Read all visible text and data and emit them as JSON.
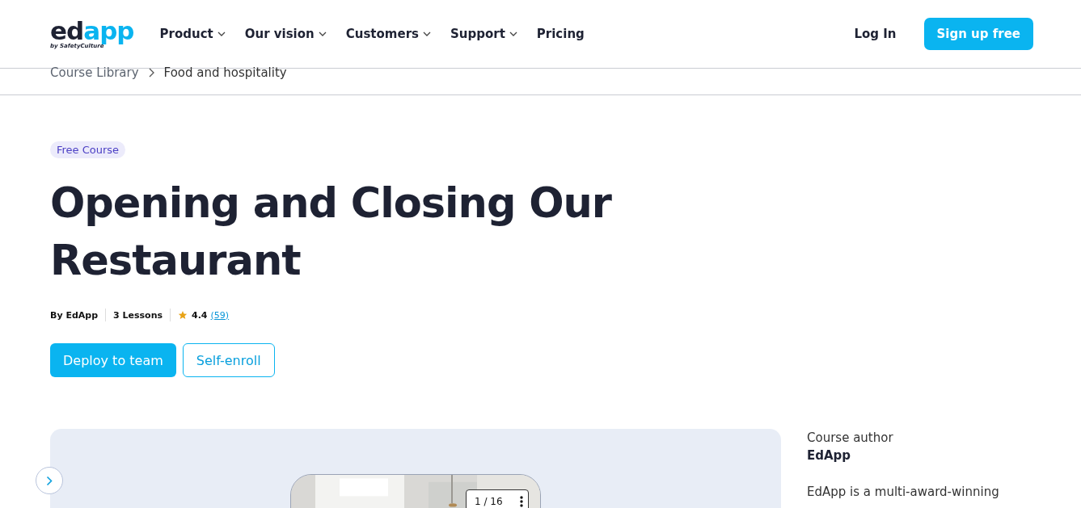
{
  "logo": {
    "primary": "ed",
    "accent": "app",
    "tagline": "by SafetyCulture"
  },
  "nav": [
    {
      "label": "Product",
      "dropdown": true
    },
    {
      "label": "Our vision",
      "dropdown": true
    },
    {
      "label": "Customers",
      "dropdown": true
    },
    {
      "label": "Support",
      "dropdown": true
    },
    {
      "label": "Pricing",
      "dropdown": false
    }
  ],
  "header_actions": {
    "login": "Log In",
    "signup": "Sign up free"
  },
  "breadcrumb": [
    "Course Library",
    "Food and hospitality"
  ],
  "badge": "Free Course",
  "title": "Opening and Closing Our Restaurant",
  "meta": {
    "author": "By EdApp",
    "lessons": "3 Lessons",
    "rating": "4.4",
    "reviews": "(59)"
  },
  "buttons": [
    {
      "label": "Deploy to team",
      "kind": "primary"
    },
    {
      "label": "Self-enroll",
      "kind": "outline"
    }
  ],
  "preview": {
    "kind": "picture",
    "counter": "1 / 16"
  },
  "sidebar": {
    "label": "Course author",
    "author": "EdApp",
    "description": "EdApp is a multi-award-winning"
  }
}
